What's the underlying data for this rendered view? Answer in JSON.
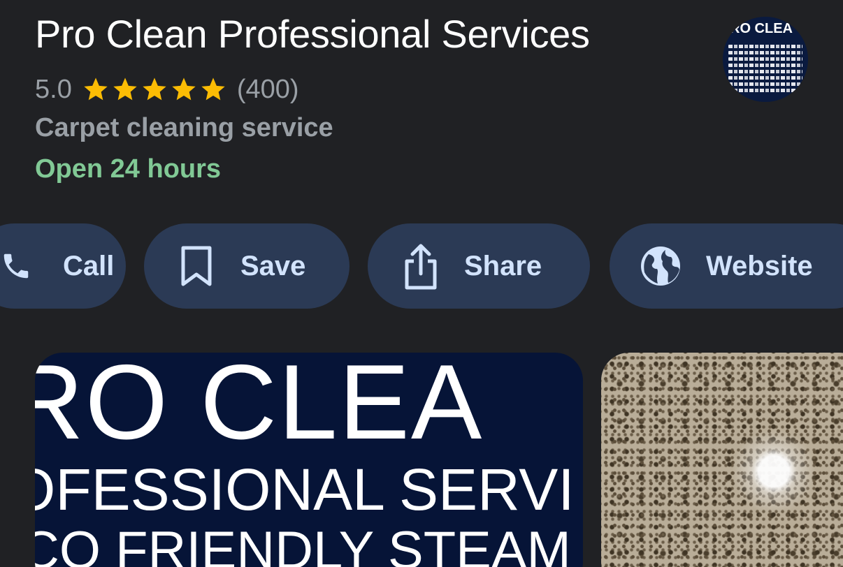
{
  "place": {
    "name": "Pro Clean Professional Services",
    "rating": "5.0",
    "stars": 5,
    "review_count": "(400)",
    "category": "Carpet cleaning service",
    "hours_status": "Open 24 hours",
    "logo_text": "RO CLEA"
  },
  "actions": [
    {
      "label": "Call",
      "icon": "phone-icon"
    },
    {
      "label": "Save",
      "icon": "bookmark-icon"
    },
    {
      "label": "Share",
      "icon": "share-icon"
    },
    {
      "label": "Website",
      "icon": "globe-icon"
    }
  ],
  "photos": {
    "main_lines": [
      "RO CLEA",
      "OFESSIONAL SERVI",
      "CO FRIENDLY STEAM & D"
    ]
  },
  "colors": {
    "background": "#202124",
    "star": "#fbbc04",
    "open_status": "#81c995",
    "chip_background": "#2b3a55",
    "chip_text": "#d2e3fc"
  }
}
